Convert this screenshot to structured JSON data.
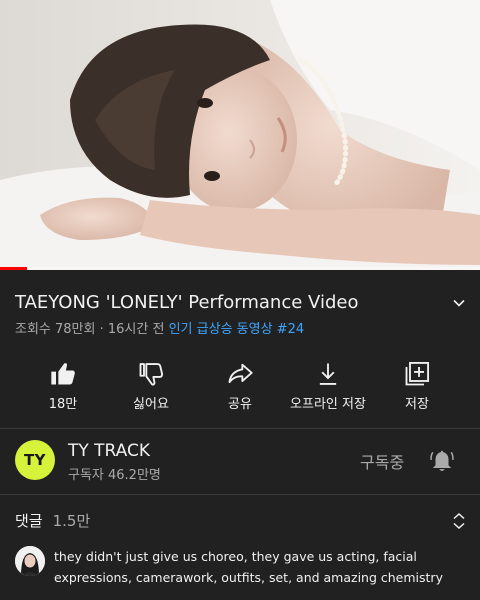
{
  "video": {
    "thumbnail_description": "",
    "progress_fraction": 0.057
  },
  "title": {
    "text": "TAEYONG 'LONELY' Performance Video",
    "expand_icon": "chevron-down-icon"
  },
  "meta": {
    "views": "조회수 78만회",
    "separator": " · ",
    "time": "16시간 전",
    "trending": "인기 급상승 동영상 #24"
  },
  "actions": [
    {
      "icon": "thumbs-up-icon",
      "label": "18만"
    },
    {
      "icon": "thumbs-down-icon",
      "label": "싫어요"
    },
    {
      "icon": "share-icon",
      "label": "공유"
    },
    {
      "icon": "download-icon",
      "label": "오프라인 저장"
    },
    {
      "icon": "add-to-playlist-icon",
      "label": "저장"
    }
  ],
  "channel": {
    "avatar_text": "TY",
    "avatar_color": "#d7f23b",
    "name": "TY TRACK",
    "subscribers": "구독자 46.2만명",
    "subscribed_label": "구독중",
    "bell_icon": "bell-icon"
  },
  "comments": {
    "title": "댓글",
    "count": "1.5만",
    "sort_icon": "unfold-icon",
    "top_comment": {
      "text": "they didn't just give us choreo, they gave us acting, facial expressions, camerawork, outfits, set, and amazing chemistry"
    }
  },
  "colors": {
    "background": "#212121",
    "accent_link": "#3ea6ff",
    "progress": "#ff0000",
    "secondary_text": "#aaaaaa"
  }
}
